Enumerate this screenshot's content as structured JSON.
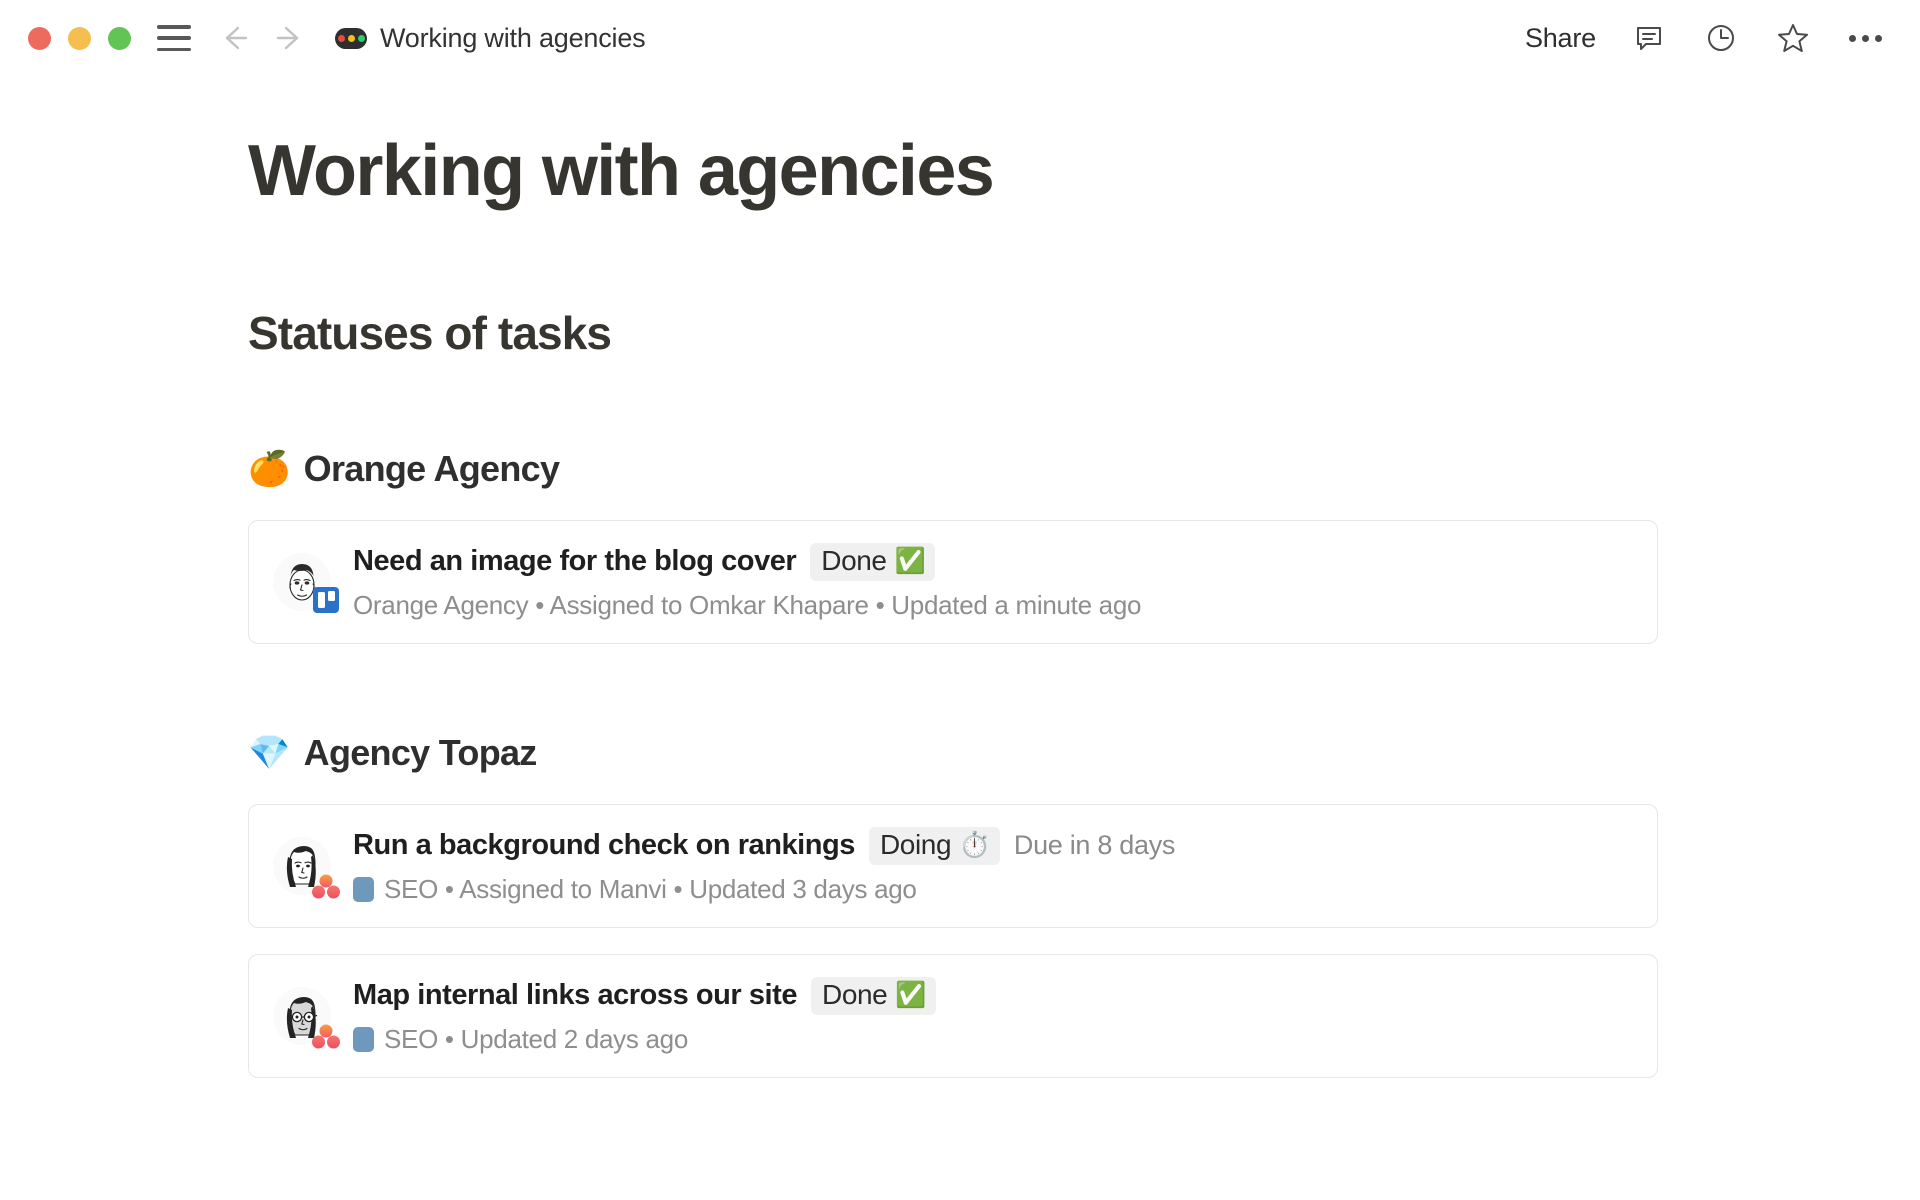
{
  "window": {
    "traffic_lights": [
      "close",
      "minimize",
      "maximize"
    ],
    "colors": {
      "close": "#ED6A5E",
      "minimize": "#F4BF4F",
      "maximize": "#61C454",
      "accent_blue": "#2A72C9",
      "tag_blue": "#6F98BD",
      "done_green": "#23C343"
    }
  },
  "titlebar": {
    "tab_title": "Working with agencies",
    "share_label": "Share",
    "icons": {
      "menu": "hamburger-icon",
      "back": "back-arrow-icon",
      "forward": "forward-arrow-icon",
      "favicon": "traffic-light-favicon",
      "comments": "comment-icon",
      "history": "clock-icon",
      "favorite": "star-icon",
      "more": "more-options-icon"
    }
  },
  "page": {
    "title": "Working with agencies",
    "section_heading": "Statuses of tasks"
  },
  "groups": [
    {
      "emoji": "🍊",
      "emoji_name": "tangerine-emoji",
      "name": "Orange Agency",
      "tasks": [
        {
          "avatar": "avatar-omkar",
          "badge": "trello-badge",
          "title": "Need an image for the blog cover",
          "status": "Done",
          "status_emoji": "✅",
          "due": "",
          "tag": "",
          "has_tag_swatch": false,
          "meta": "Orange Agency • Assigned to Omkar Khapare • Updated a minute ago"
        }
      ]
    },
    {
      "emoji": "💎",
      "emoji_name": "gem-stone-emoji",
      "name": "Agency Topaz",
      "tasks": [
        {
          "avatar": "avatar-manvi",
          "badge": "asana-badge",
          "title": "Run a background check on rankings",
          "status": "Doing",
          "status_emoji": "⏱️",
          "due": "Due in 8 days",
          "tag": "SEO",
          "has_tag_swatch": true,
          "meta": "SEO • Assigned to Manvi • Updated 3 days ago"
        },
        {
          "avatar": "avatar-glasses",
          "badge": "asana-badge",
          "title": "Map internal links across our site",
          "status": "Done",
          "status_emoji": "✅",
          "due": "",
          "tag": "SEO",
          "has_tag_swatch": true,
          "meta": "SEO • Updated 2 days ago"
        }
      ]
    }
  ]
}
